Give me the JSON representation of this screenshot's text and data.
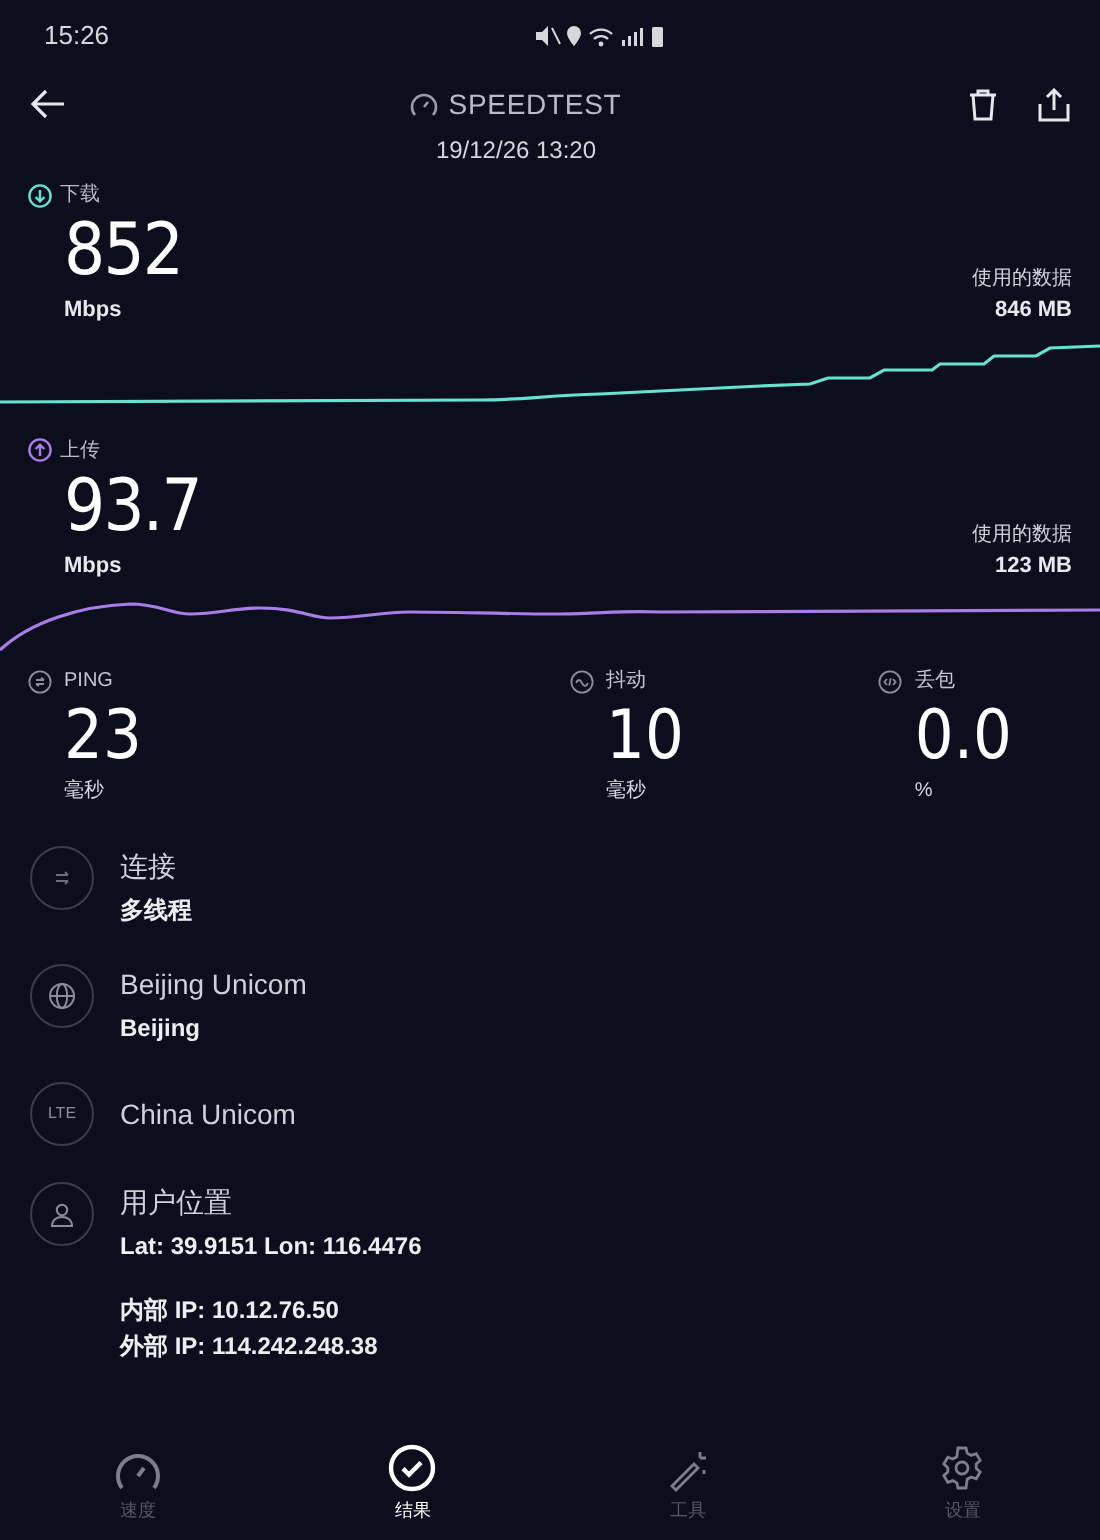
{
  "status_bar": {
    "time": "15:26"
  },
  "header": {
    "title": "SPEEDTEST",
    "date": "19/12/26 13:20"
  },
  "download": {
    "label": "下载",
    "value": "852",
    "unit": "Mbps",
    "data_label": "使用的数据",
    "data_value": "846 MB"
  },
  "upload": {
    "label": "上传",
    "value": "93.7",
    "unit": "Mbps",
    "data_label": "使用的数据",
    "data_value": "123 MB"
  },
  "metrics": [
    {
      "kind": "ping",
      "label": "PING",
      "value": "23",
      "unit": "毫秒"
    },
    {
      "kind": "jitter",
      "label": "抖动",
      "value": "10",
      "unit": "毫秒"
    },
    {
      "kind": "loss",
      "label": "丢包",
      "value": "0.0",
      "unit": "%"
    }
  ],
  "info": [
    {
      "kind": "connection",
      "title": "连接",
      "lines": [
        "多线程"
      ]
    },
    {
      "kind": "server",
      "title": "Beijing Unicom",
      "lines": [
        "Beijing"
      ]
    },
    {
      "kind": "provider",
      "icon_text": "LTE",
      "title": "China Unicom"
    },
    {
      "kind": "location",
      "title": "用户位置",
      "lines": [
        "Lat: 39.9151 Lon: 116.4476"
      ],
      "extra": [
        "内部 IP: 10.12.76.50",
        "外部 IP: 114.242.248.38"
      ]
    }
  ],
  "nav": [
    {
      "kind": "speed",
      "label": "速度",
      "selected": false
    },
    {
      "kind": "results",
      "label": "结果",
      "selected": true
    },
    {
      "kind": "tools",
      "label": "工具",
      "selected": false
    },
    {
      "kind": "settings",
      "label": "设置",
      "selected": false
    }
  ]
}
